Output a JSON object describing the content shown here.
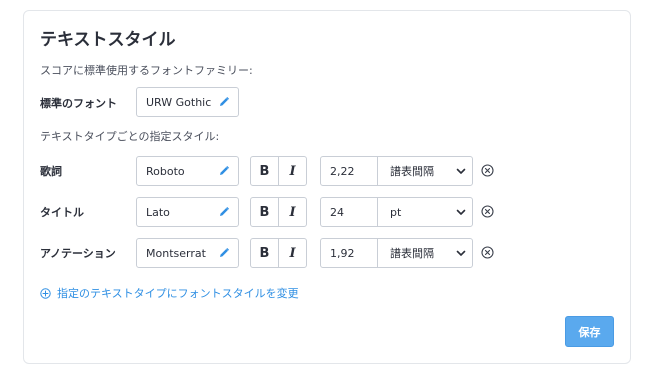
{
  "title": "テキストスタイル",
  "score_fonts_label": "スコアに標準使用するフォントファミリー:",
  "default_font": {
    "label": "標準のフォント",
    "value": "URW Gothic"
  },
  "per_type_label": "テキストタイプごとの指定スタイル:",
  "rows": [
    {
      "label": "歌詞",
      "font": "Roboto",
      "bold": "B",
      "italic": "I",
      "spacing": "2,22",
      "unit": "譜表間隔"
    },
    {
      "label": "タイトル",
      "font": "Lato",
      "bold": "B",
      "italic": "I",
      "spacing": "24",
      "unit": "pt"
    },
    {
      "label": "アノテーション",
      "font": "Montserrat",
      "bold": "B",
      "italic": "I",
      "spacing": "1,92",
      "unit": "譜表間隔"
    }
  ],
  "add_link": "指定のテキストタイプにフォントスタイルを変更",
  "save_label": "保存",
  "colors": {
    "accent": "#2f8fe3",
    "save_button": "#5aa9ee",
    "border": "#c9ced6"
  },
  "icons": {
    "edit": "pencil-icon",
    "dropdown": "chevron-down-icon",
    "remove": "circle-x-icon",
    "add": "circle-plus-icon"
  }
}
